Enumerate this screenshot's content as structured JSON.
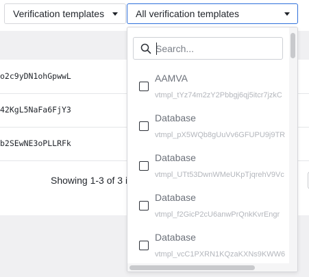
{
  "filters": {
    "template_type_label": "Verification templates",
    "template_select_label": "All verification templates"
  },
  "table": {
    "rows": [
      "o2c9yDN1ohGpwwL",
      "42KgL5NaFa6FjY3",
      "b2SEwNE3oPLLRFk"
    ]
  },
  "pagination": {
    "showing": "Showing 1-3 of 3 it"
  },
  "dropdown": {
    "search_placeholder": "Search...",
    "options": [
      {
        "title": "AAMVA",
        "id": "vtmpl_tYz74m2zY2Pbbgj6qj5itcr7jzkC"
      },
      {
        "title": "Database",
        "id": "vtmpl_pX5WQb8gUuVv6GFUPU9j9TR"
      },
      {
        "title": "Database",
        "id": "vtmpl_UTt53DwnWMeUKpTjqrehV9Vc"
      },
      {
        "title": "Database",
        "id": "vtmpl_f2GicP2cU6anwPrQnkKvrEngr"
      },
      {
        "title": "Database",
        "id": "vtmpl_vcC1PXRN1KQzaKXNs9KWW6"
      }
    ]
  },
  "colors": {
    "accent_border": "#2d6fdb",
    "panel_gray": "#f0f0f2"
  }
}
